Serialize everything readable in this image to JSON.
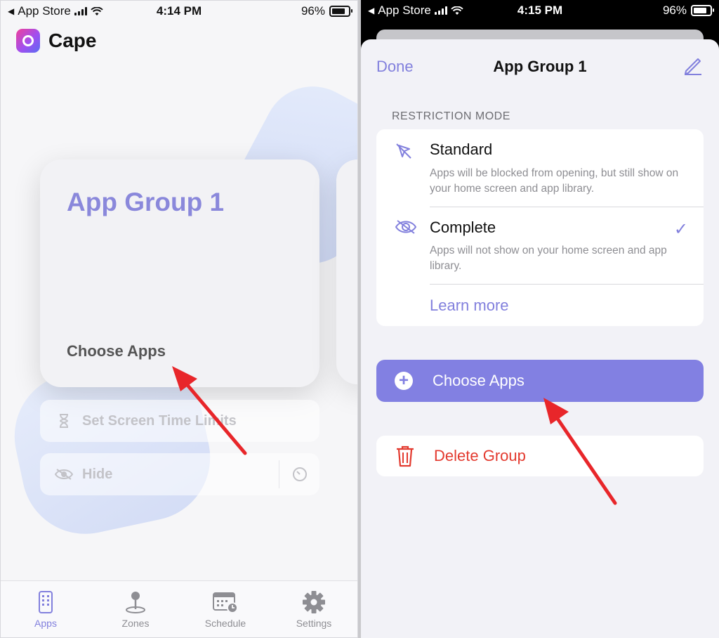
{
  "left_screen": {
    "status": {
      "carrier": "App Store",
      "time": "4:14 PM",
      "battery": "96%"
    },
    "app_title": "Cape",
    "card": {
      "title": "App Group 1",
      "choose_apps": "Choose Apps"
    },
    "options": {
      "screen_time": "Set Screen Time Limits",
      "hide": "Hide"
    },
    "tabs": [
      {
        "label": "Apps",
        "icon": "phone-icon",
        "active": true
      },
      {
        "label": "Zones",
        "icon": "location-pin-icon",
        "active": false
      },
      {
        "label": "Schedule",
        "icon": "calendar-clock-icon",
        "active": false
      },
      {
        "label": "Settings",
        "icon": "gear-icon",
        "active": false
      }
    ]
  },
  "right_screen": {
    "status": {
      "carrier": "App Store",
      "time": "4:15 PM",
      "battery": "96%"
    },
    "nav": {
      "done": "Done",
      "title": "App Group 1"
    },
    "section_label": "RESTRICTION MODE",
    "modes": [
      {
        "title": "Standard",
        "description": "Apps will be blocked from opening, but still show on your home screen and app library.",
        "selected": false
      },
      {
        "title": "Complete",
        "description": "Apps will not show on your home screen and app library.",
        "selected": true
      }
    ],
    "learn_more": "Learn more",
    "choose_apps_button": "Choose Apps",
    "delete_group_button": "Delete Group"
  },
  "colors": {
    "accent": "#8280dd",
    "button": "#8280e2",
    "destructive": "#e33a2f",
    "annotation_arrow": "#e8262a"
  }
}
